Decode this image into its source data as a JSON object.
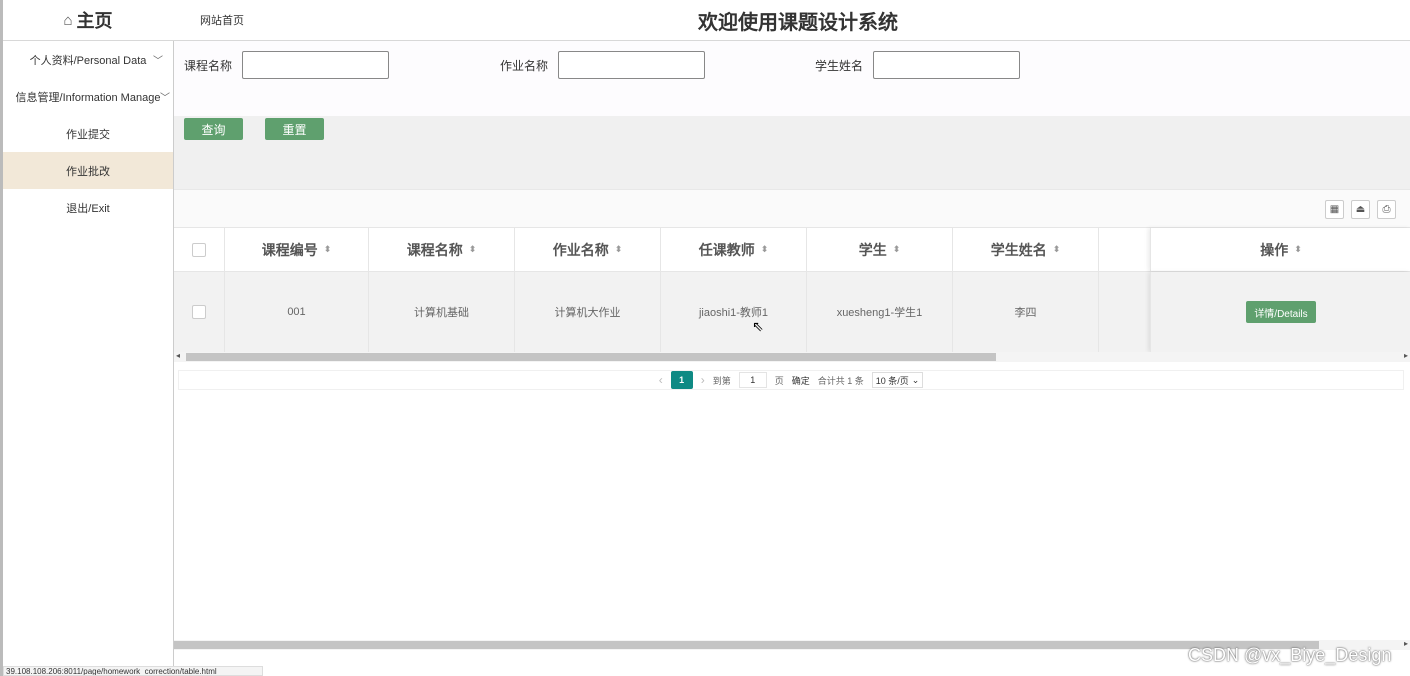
{
  "header": {
    "brand": "主页",
    "site_link": "网站首页",
    "welcome": "欢迎使用课题设计系统"
  },
  "sidebar": {
    "items": [
      {
        "label": "个人资料/Personal Data",
        "expandable": true
      },
      {
        "label": "信息管理/Information Manage",
        "expandable": true
      },
      {
        "label": "作业提交",
        "expandable": false
      },
      {
        "label": "作业批改",
        "expandable": false,
        "active": true
      },
      {
        "label": "退出/Exit",
        "expandable": false
      }
    ]
  },
  "search": {
    "course_name_label": "课程名称",
    "course_name_value": "",
    "homework_name_label": "作业名称",
    "homework_name_value": "",
    "student_name_label": "学生姓名",
    "student_name_value": "",
    "query_button": "查询",
    "reset_button": "重置"
  },
  "toolbar": {
    "icons": [
      "columns-icon",
      "export-icon",
      "print-icon"
    ]
  },
  "table": {
    "columns": [
      "课程编号",
      "课程名称",
      "作业名称",
      "任课教师",
      "学生",
      "学生姓名",
      "操作"
    ],
    "rows": [
      {
        "course_no": "001",
        "course_name": "计算机基础",
        "homework_name": "计算机大作业",
        "teacher": "jiaoshi1-教师1",
        "student": "xuesheng1-学生1",
        "student_name": "李四",
        "action": "详情/Details"
      }
    ]
  },
  "pagination": {
    "current_page": "1",
    "goto_label": "到第",
    "goto_value": "1",
    "page_unit": "页",
    "confirm": "确定",
    "total": "合计共 1 条",
    "page_size": "10 条/页"
  },
  "status_url": "39.108.108.206:8011/page/homework_correction/table.html",
  "watermark": "CSDN @vx_Biye_Design",
  "colors": {
    "primary_button": "#5fa06e",
    "pager_active": "#0f8a84",
    "active_sidebar": "#f2e8d8"
  }
}
